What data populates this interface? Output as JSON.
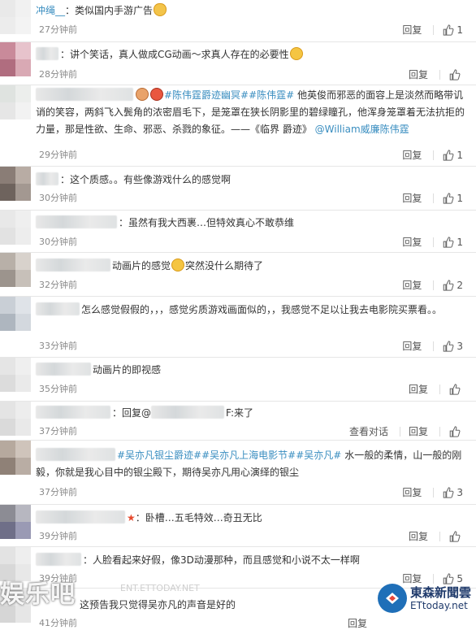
{
  "comments": [
    {
      "user": "冲绳__",
      "text": "：类似国内手游广告",
      "time": "27分钟前",
      "reply": "回复",
      "likes": "1"
    },
    {
      "user": "",
      "text": "：讲个笑话，真人做成CG动画～求真人存在的必要性",
      "time": "28分钟前",
      "reply": "回复",
      "likes": ""
    },
    {
      "tags": [
        "#陈伟霆爵迹幽冥#",
        "#陈伟霆#"
      ],
      "text": "他英俊而邪恶的面容上是淡然而略带讥诮的笑容，两斜飞入鬓角的浓密眉毛下，是笼罩在狭长阴影里的碧绿瞳孔，他浑身笼罩着无法抗拒的力量，那是性欲、生命、邪恶、杀戮的象征。——《临界 爵迹》",
      "mention": "@William威廉陈伟霆",
      "time": "29分钟前",
      "reply": "回复",
      "likes": "1"
    },
    {
      "text": "：这个质感。。有些像游戏什么的感觉啊",
      "time": "30分钟前",
      "reply": "回复",
      "likes": "1"
    },
    {
      "text": "：虽然有我大西裹…但特效真心不敢恭维",
      "time": "30分钟前",
      "reply": "回复",
      "likes": "1"
    },
    {
      "text": "动画片的感觉",
      "text2": "突然没什么期待了",
      "time": "32分钟前",
      "reply": "回复",
      "likes": "2"
    },
    {
      "text": "怎么感觉假假的，，，感觉劣质游戏画面似的，，我感觉不足以让我去电影院买票看。。",
      "time": "33分钟前",
      "reply": "回复",
      "likes": "3"
    },
    {
      "text": "动画片的即视感",
      "time": "35分钟前",
      "reply": "回复",
      "likes": ""
    },
    {
      "text_prefix": "：回复@",
      "text_suffix": "F:来了",
      "time": "37分钟前",
      "conversation": "查看对话",
      "reply": "回复",
      "likes": ""
    },
    {
      "tags": [
        "#吴亦凡银尘爵迹#",
        "#吴亦凡上海电影节#",
        "#吴亦凡#"
      ],
      "text": "水一般的柔情，山一般的刚毅，你就是我心目中的银尘殿下，期待吴亦凡用心演绎的银尘",
      "time": "37分钟前",
      "reply": "回复",
      "likes": "3"
    },
    {
      "text": "：卧槽…五毛特效…奇丑无比",
      "time": "39分钟前",
      "reply": "回复",
      "likes": ""
    },
    {
      "text": "：人脸看起来好假，像3D动漫那种，而且感觉和小说不太一样啊",
      "time": "39分钟前",
      "reply": "回复",
      "likes": "5"
    },
    {
      "text": "这预告我只觉得吴亦凡的声音是好的",
      "time": "41分钟前",
      "reply": "回复",
      "likes": "3"
    }
  ],
  "watermark": {
    "left": "娱乐吧",
    "faint": "ENT.ETTODAY.NET",
    "right_name": "東森新聞雲",
    "right_url": "ETtoday.net"
  },
  "icons": {
    "like": "thumbs-up-icon",
    "emoji": "emoji-icon"
  }
}
